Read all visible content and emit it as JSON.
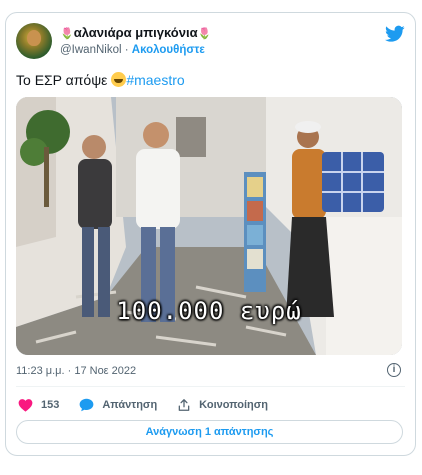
{
  "author": {
    "display_name": "αλανιάρα μπιγκόνια",
    "flower_icon": "🌷",
    "handle": "@IwanNikol",
    "separator": "·",
    "follow_label": "Ακολουθήστε"
  },
  "tweet": {
    "text": "Το ΕΣΡ απόψε ",
    "emoji_name": "rolling-on-floor-laughing-emoji",
    "hashtag": "#maestro"
  },
  "media": {
    "subtitle": "100.000 ευρώ"
  },
  "meta": {
    "timestamp": "11:23 μ.μ. · 17 Νοε 2022",
    "info_glyph": "i"
  },
  "actions": {
    "like_count": "153",
    "reply_label": "Απάντηση",
    "share_label": "Κοινοποίηση"
  },
  "read_replies_label": "Ανάγνωση 1 απάντησης",
  "colors": {
    "accent": "#1d9bf0",
    "like": "#f91880",
    "muted": "#536471",
    "border": "#cfd9de"
  }
}
